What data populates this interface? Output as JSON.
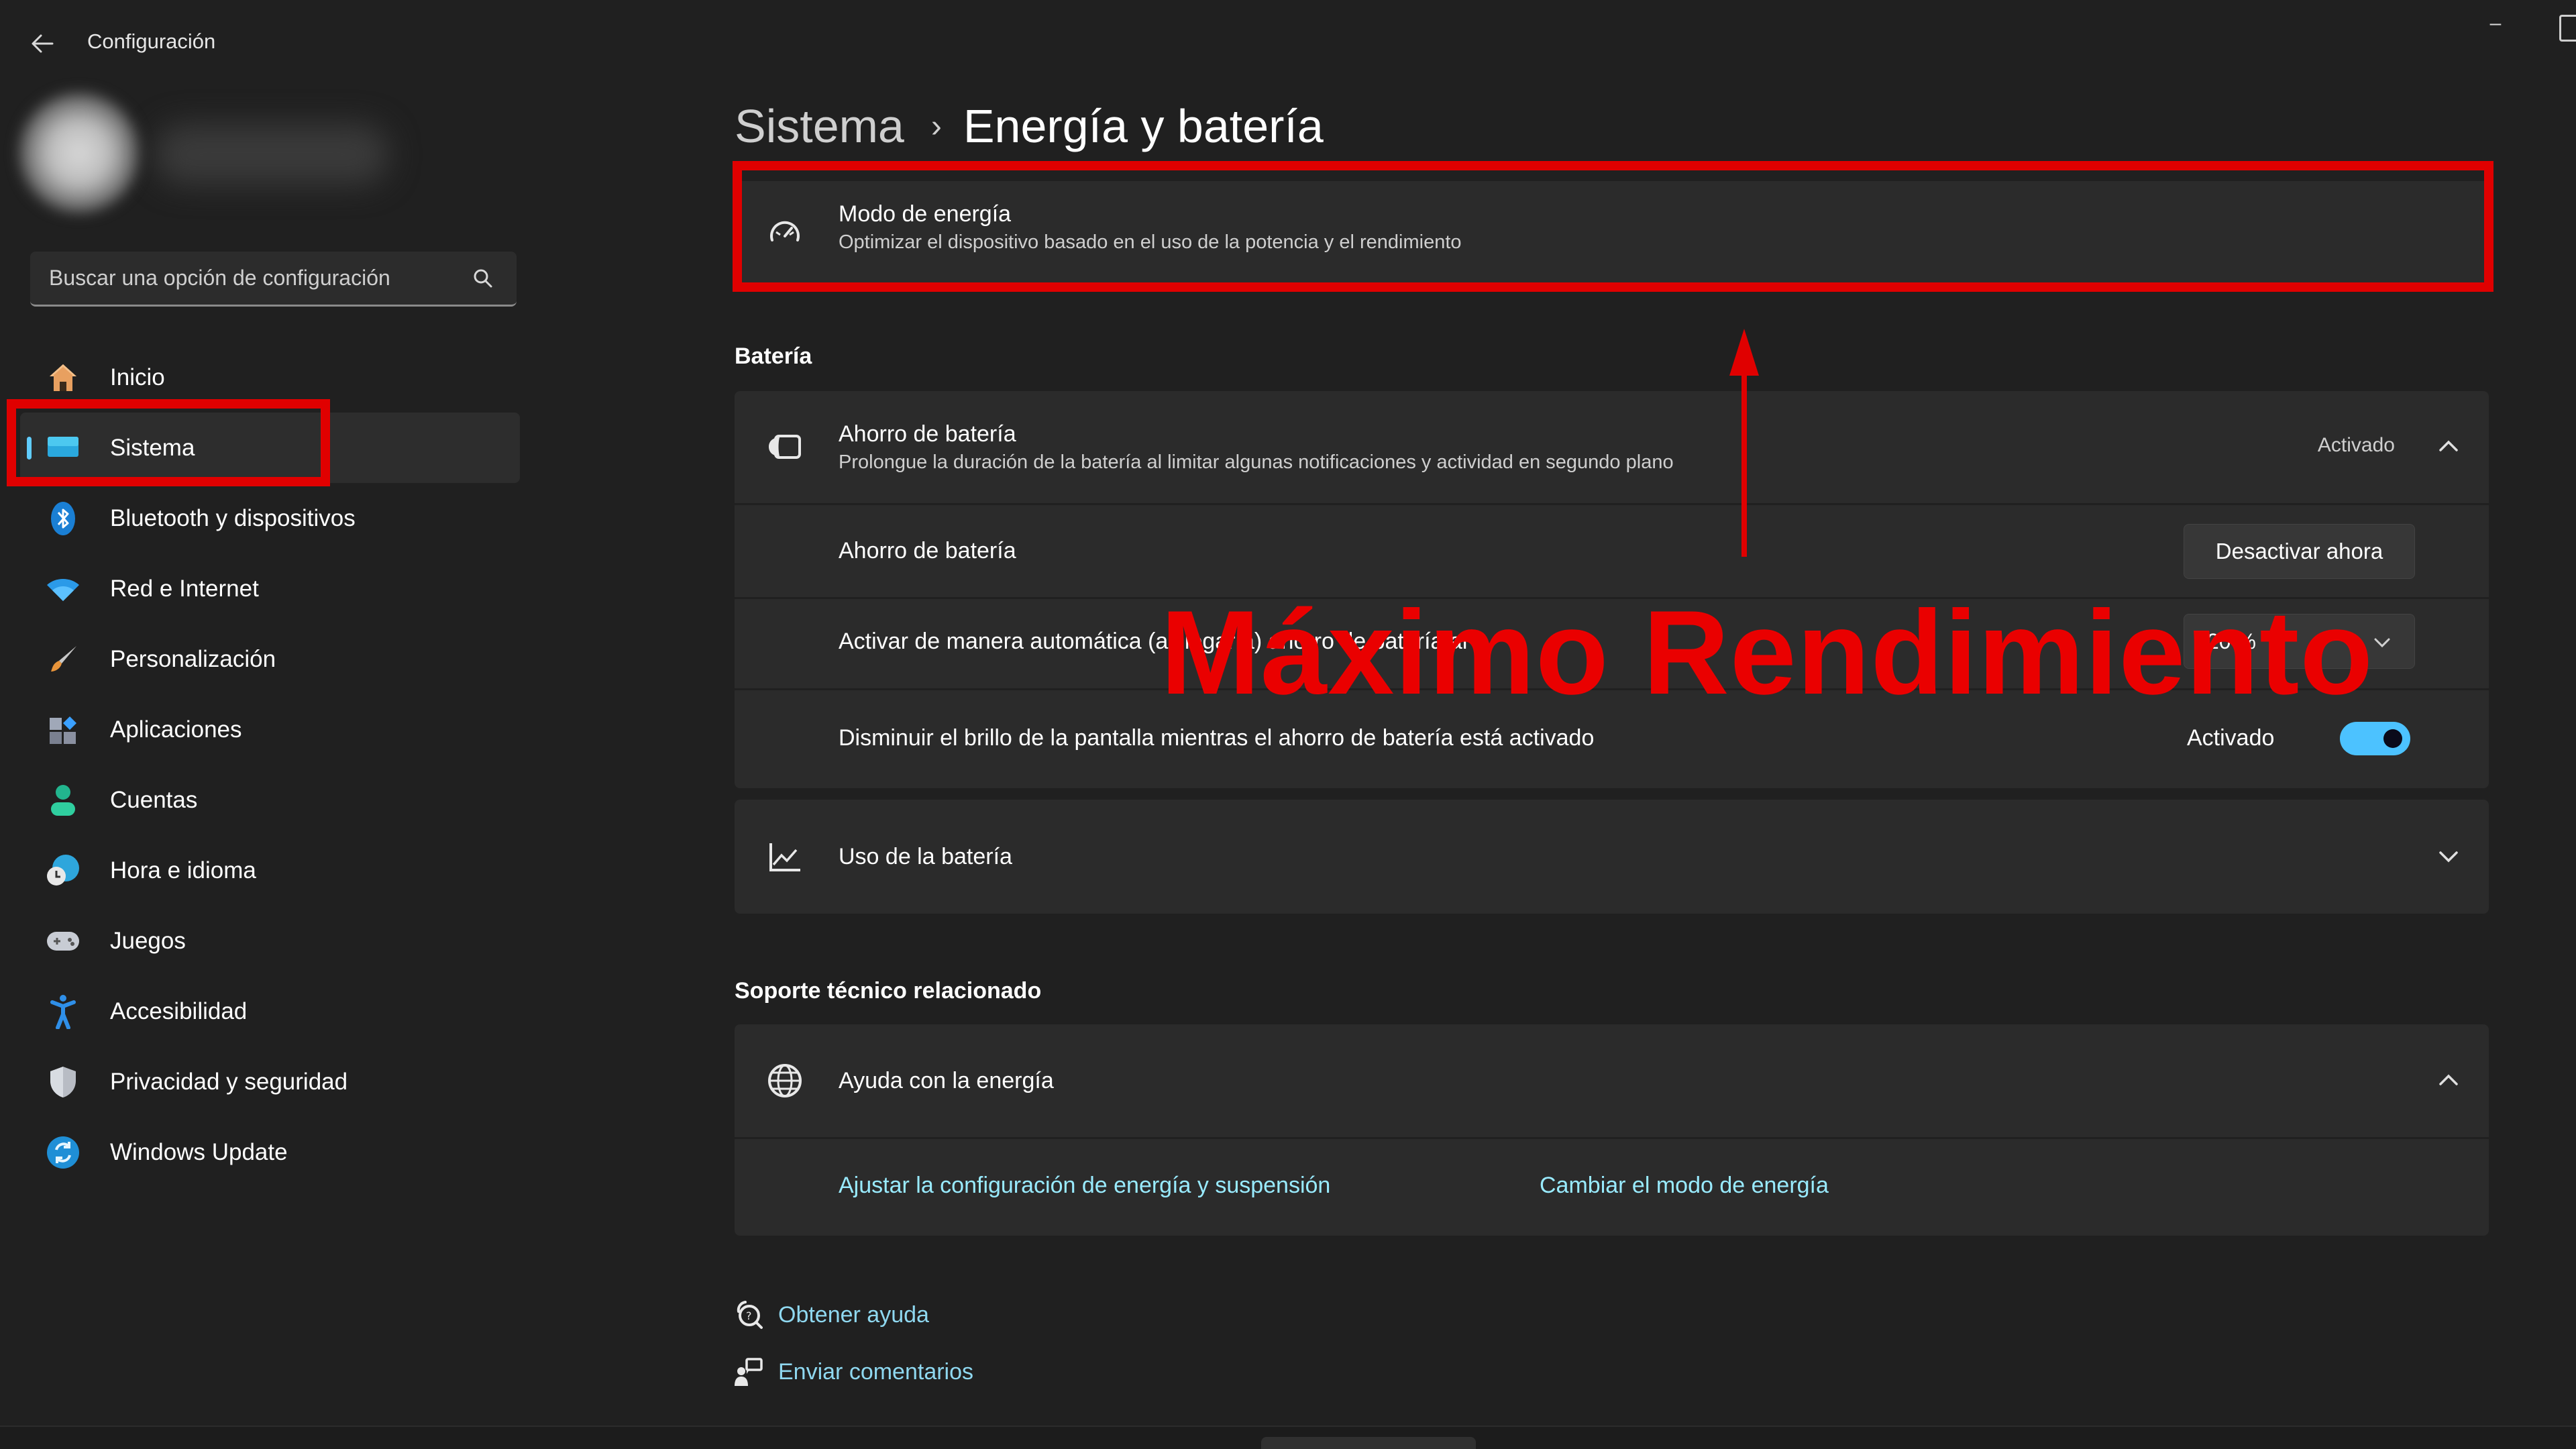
{
  "window": {
    "title": "Configuración",
    "back_icon": "arrow-left-icon",
    "minimize_icon": "minimize-icon",
    "maximize_icon": "maximize-icon"
  },
  "search": {
    "placeholder": "Buscar una opción de configuración",
    "value": "",
    "icon": "search-icon"
  },
  "sidebar": {
    "active_index": 1,
    "items": [
      {
        "label": "Inicio",
        "icon": "home-icon"
      },
      {
        "label": "Sistema",
        "icon": "system-display-icon"
      },
      {
        "label": "Bluetooth y dispositivos",
        "icon": "bluetooth-icon"
      },
      {
        "label": "Red e Internet",
        "icon": "wifi-icon"
      },
      {
        "label": "Personalización",
        "icon": "paintbrush-icon"
      },
      {
        "label": "Aplicaciones",
        "icon": "apps-icon"
      },
      {
        "label": "Cuentas",
        "icon": "person-icon"
      },
      {
        "label": "Hora e idioma",
        "icon": "clock-globe-icon"
      },
      {
        "label": "Juegos",
        "icon": "gamepad-icon"
      },
      {
        "label": "Accesibilidad",
        "icon": "accessibility-icon"
      },
      {
        "label": "Privacidad y seguridad",
        "icon": "shield-icon"
      },
      {
        "label": "Windows Update",
        "icon": "sync-icon"
      }
    ]
  },
  "breadcrumb": {
    "parent": "Sistema",
    "separator": "›",
    "current": "Energía y batería"
  },
  "power_mode": {
    "title": "Modo de energía",
    "subtitle": "Optimizar el dispositivo basado en el uso de la potencia y el rendimiento",
    "icon": "power-mode-gauge-icon"
  },
  "battery_section": {
    "label": "Batería",
    "saver": {
      "title": "Ahorro de batería",
      "subtitle": "Prolongue la duración de la batería al limitar algunas notificaciones y actividad en segundo plano",
      "status": "Activado",
      "icon": "battery-saver-icon",
      "expanded": true,
      "rows": {
        "saver_row_label": "Ahorro de batería",
        "saver_button": "Desactivar ahora",
        "auto_label": "Activar de manera automática (al llegar a) ahorro de batería al",
        "auto_value": "20 %",
        "dim_label": "Disminuir el brillo de la pantalla mientras el ahorro de batería está activado",
        "dim_status": "Activado",
        "dim_on": true
      }
    },
    "usage": {
      "title": "Uso de la batería",
      "icon": "line-chart-icon",
      "expanded": false
    }
  },
  "support_section": {
    "label": "Soporte técnico relacionado",
    "help": {
      "title": "Ayuda con la energía",
      "icon": "globe-help-icon",
      "expanded": true,
      "links": [
        "Ajustar la configuración de energía y suspensión",
        "Cambiar el modo de energía"
      ]
    }
  },
  "footer_links": [
    {
      "label": "Obtener ayuda",
      "icon": "get-help-icon"
    },
    {
      "label": "Enviar comentarios",
      "icon": "feedback-icon"
    }
  ],
  "annotation": {
    "overlay_text": "Máximo Rendimiento",
    "color": "#e00000"
  },
  "colors": {
    "accent": "#4cc2ff",
    "link": "#99ebff",
    "background": "#202020",
    "card": "#2b2b2b"
  }
}
